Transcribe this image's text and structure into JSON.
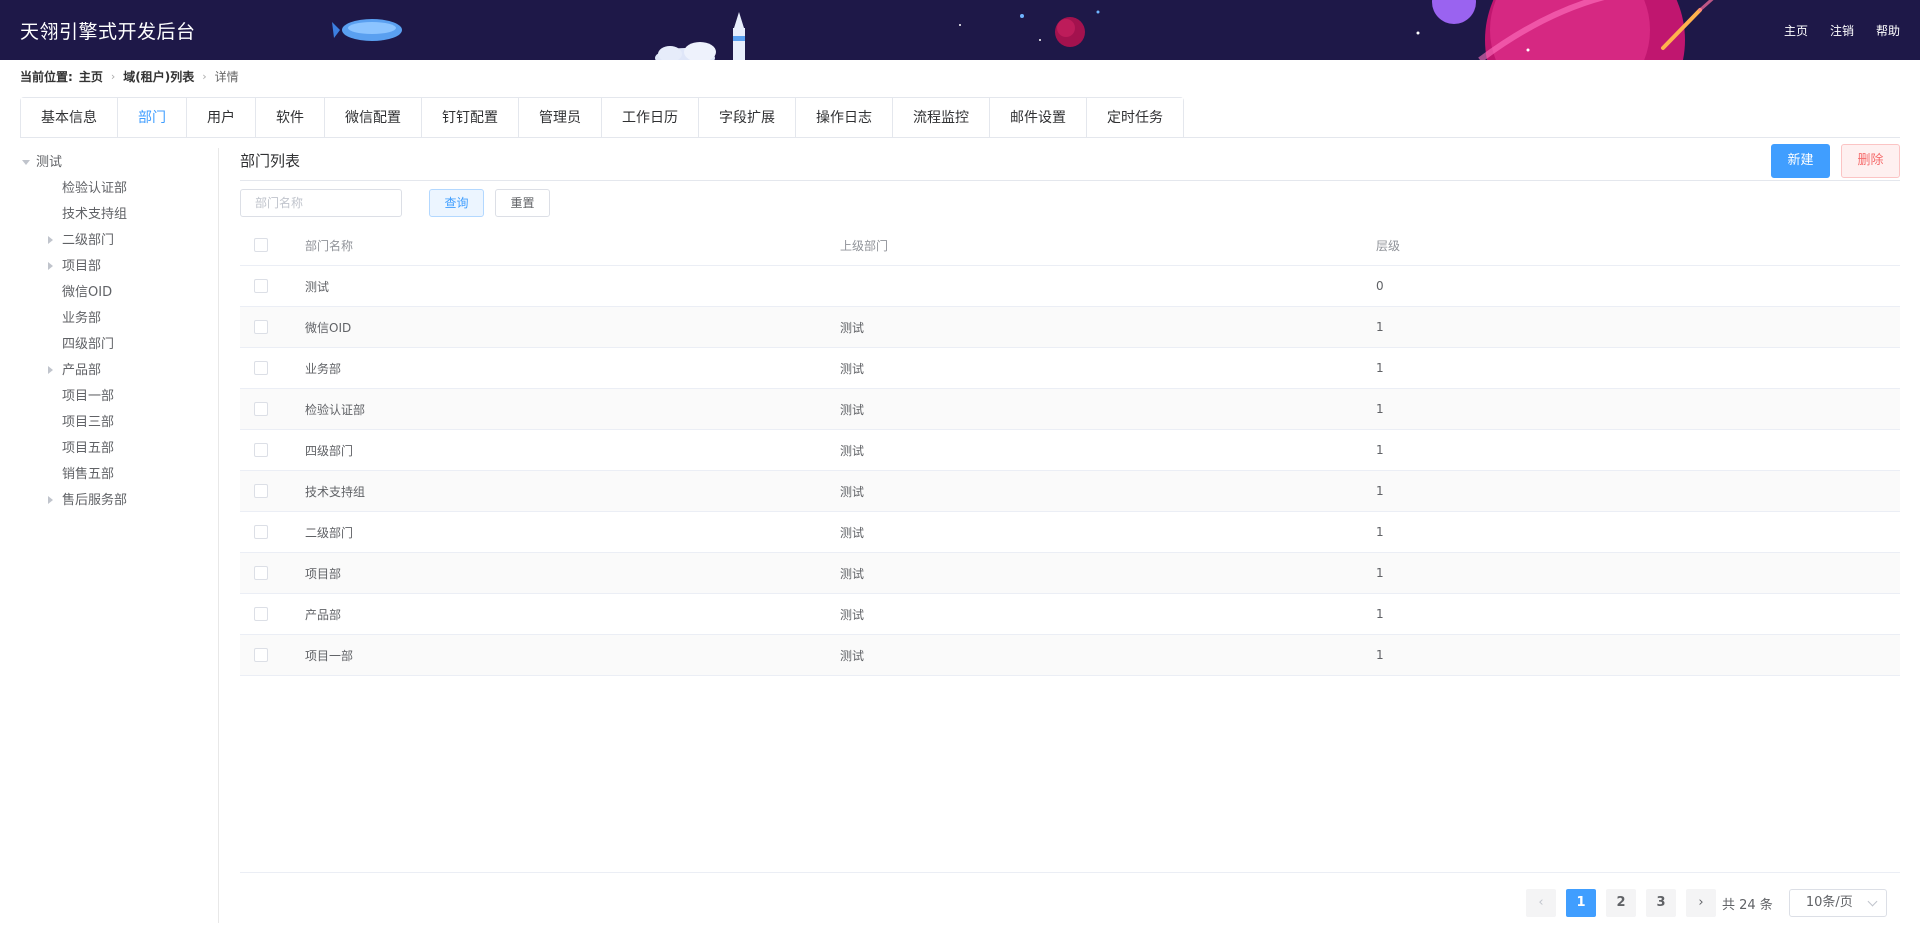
{
  "header": {
    "title": "天翎引擎式开发后台",
    "nav": [
      "主页",
      "注销",
      "帮助"
    ],
    "bg_color": "#1e1848"
  },
  "breadcrumb": {
    "label": "当前位置:",
    "items": [
      "主页",
      "域(租户)列表",
      "详情"
    ]
  },
  "tabs": [
    {
      "label": "基本信息",
      "active": false
    },
    {
      "label": "部门",
      "active": true
    },
    {
      "label": "用户",
      "active": false
    },
    {
      "label": "软件",
      "active": false
    },
    {
      "label": "微信配置",
      "active": false
    },
    {
      "label": "钉钉配置",
      "active": false
    },
    {
      "label": "管理员",
      "active": false
    },
    {
      "label": "工作日历",
      "active": false
    },
    {
      "label": "字段扩展",
      "active": false
    },
    {
      "label": "操作日志",
      "active": false
    },
    {
      "label": "流程监控",
      "active": false
    },
    {
      "label": "邮件设置",
      "active": false
    },
    {
      "label": "定时任务",
      "active": false
    }
  ],
  "tree": [
    {
      "label": "测试",
      "depth": 0,
      "arrow": "down"
    },
    {
      "label": "检验认证部",
      "depth": 1,
      "arrow": ""
    },
    {
      "label": "技术支持组",
      "depth": 1,
      "arrow": ""
    },
    {
      "label": "二级部门",
      "depth": 1,
      "arrow": "right"
    },
    {
      "label": "项目部",
      "depth": 1,
      "arrow": "right"
    },
    {
      "label": "微信OID",
      "depth": 1,
      "arrow": ""
    },
    {
      "label": "业务部",
      "depth": 1,
      "arrow": ""
    },
    {
      "label": "四级部门",
      "depth": 1,
      "arrow": ""
    },
    {
      "label": "产品部",
      "depth": 1,
      "arrow": "right"
    },
    {
      "label": "项目一部",
      "depth": 1,
      "arrow": ""
    },
    {
      "label": "项目三部",
      "depth": 1,
      "arrow": ""
    },
    {
      "label": "项目五部",
      "depth": 1,
      "arrow": ""
    },
    {
      "label": "销售五部",
      "depth": 1,
      "arrow": ""
    },
    {
      "label": "售后服务部",
      "depth": 1,
      "arrow": "right"
    }
  ],
  "panel": {
    "title": "部门列表",
    "new_label": "新建",
    "delete_label": "删除",
    "search_placeholder": "部门名称",
    "query_label": "查询",
    "reset_label": "重置"
  },
  "table": {
    "headers": [
      "部门名称",
      "上级部门",
      "层级"
    ],
    "rows": [
      [
        "测试",
        "",
        "0"
      ],
      [
        "微信OID",
        "测试",
        "1"
      ],
      [
        "业务部",
        "测试",
        "1"
      ],
      [
        "检验认证部",
        "测试",
        "1"
      ],
      [
        "四级部门",
        "测试",
        "1"
      ],
      [
        "技术支持组",
        "测试",
        "1"
      ],
      [
        "二级部门",
        "测试",
        "1"
      ],
      [
        "项目部",
        "测试",
        "1"
      ],
      [
        "产品部",
        "测试",
        "1"
      ],
      [
        "项目一部",
        "测试",
        "1"
      ]
    ]
  },
  "pagination": {
    "prev": "‹",
    "next": "›",
    "pages": [
      "1",
      "2",
      "3"
    ],
    "current": "1",
    "total_text": "共 24 条",
    "page_size": "10条/页"
  },
  "colors": {
    "primary": "#409eff",
    "danger": "#f56c6c"
  }
}
